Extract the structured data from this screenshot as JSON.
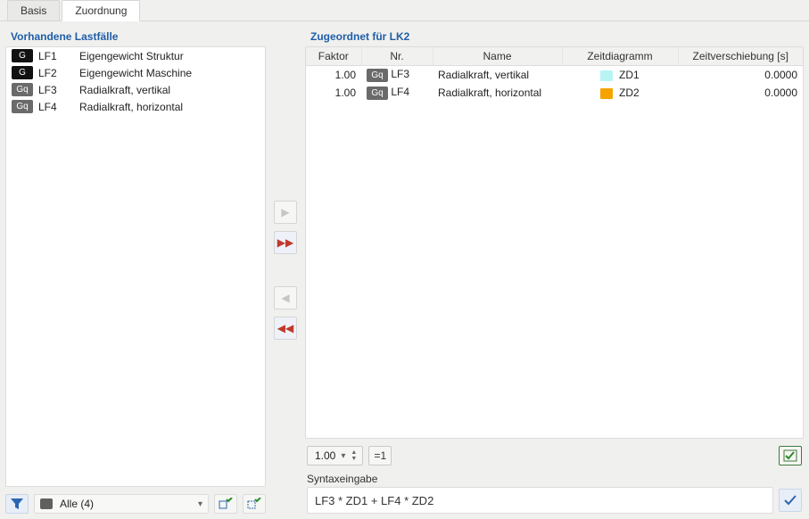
{
  "tabs": {
    "basis": "Basis",
    "zuordnung": "Zuordnung"
  },
  "left": {
    "title": "Vorhandene Lastfälle",
    "items": [
      {
        "badge": "G",
        "badgeClass": "badge-black",
        "code": "LF1",
        "name": "Eigengewicht Struktur"
      },
      {
        "badge": "G",
        "badgeClass": "badge-black",
        "code": "LF2",
        "name": "Eigengewicht Maschine"
      },
      {
        "badge": "Gq",
        "badgeClass": "badge-gray",
        "code": "LF3",
        "name": "Radialkraft, vertikal"
      },
      {
        "badge": "Gq",
        "badgeClass": "badge-gray",
        "code": "LF4",
        "name": "Radialkraft, horizontal"
      }
    ],
    "filter_label": "Alle (4)"
  },
  "right": {
    "title": "Zugeordnet für LK2",
    "headers": {
      "faktor": "Faktor",
      "nr": "Nr.",
      "name": "Name",
      "zeitdiagramm": "Zeitdiagramm",
      "zeitverschiebung": "Zeitverschiebung [s]"
    },
    "rows": [
      {
        "faktor": "1.00",
        "badge": "Gq",
        "code": "LF3",
        "name": "Radialkraft, vertikal",
        "color": "#b8f4f4",
        "zd": "ZD1",
        "shift": "0.0000"
      },
      {
        "faktor": "1.00",
        "badge": "Gq",
        "code": "LF4",
        "name": "Radialkraft, horizontal",
        "color": "#f5a300",
        "zd": "ZD2",
        "shift": "0.0000"
      }
    ],
    "spinner_value": "1.00",
    "reset_label": "=1",
    "syntax_label": "Syntaxeingabe",
    "syntax_value": "LF3 * ZD1 + LF4 * ZD2"
  }
}
